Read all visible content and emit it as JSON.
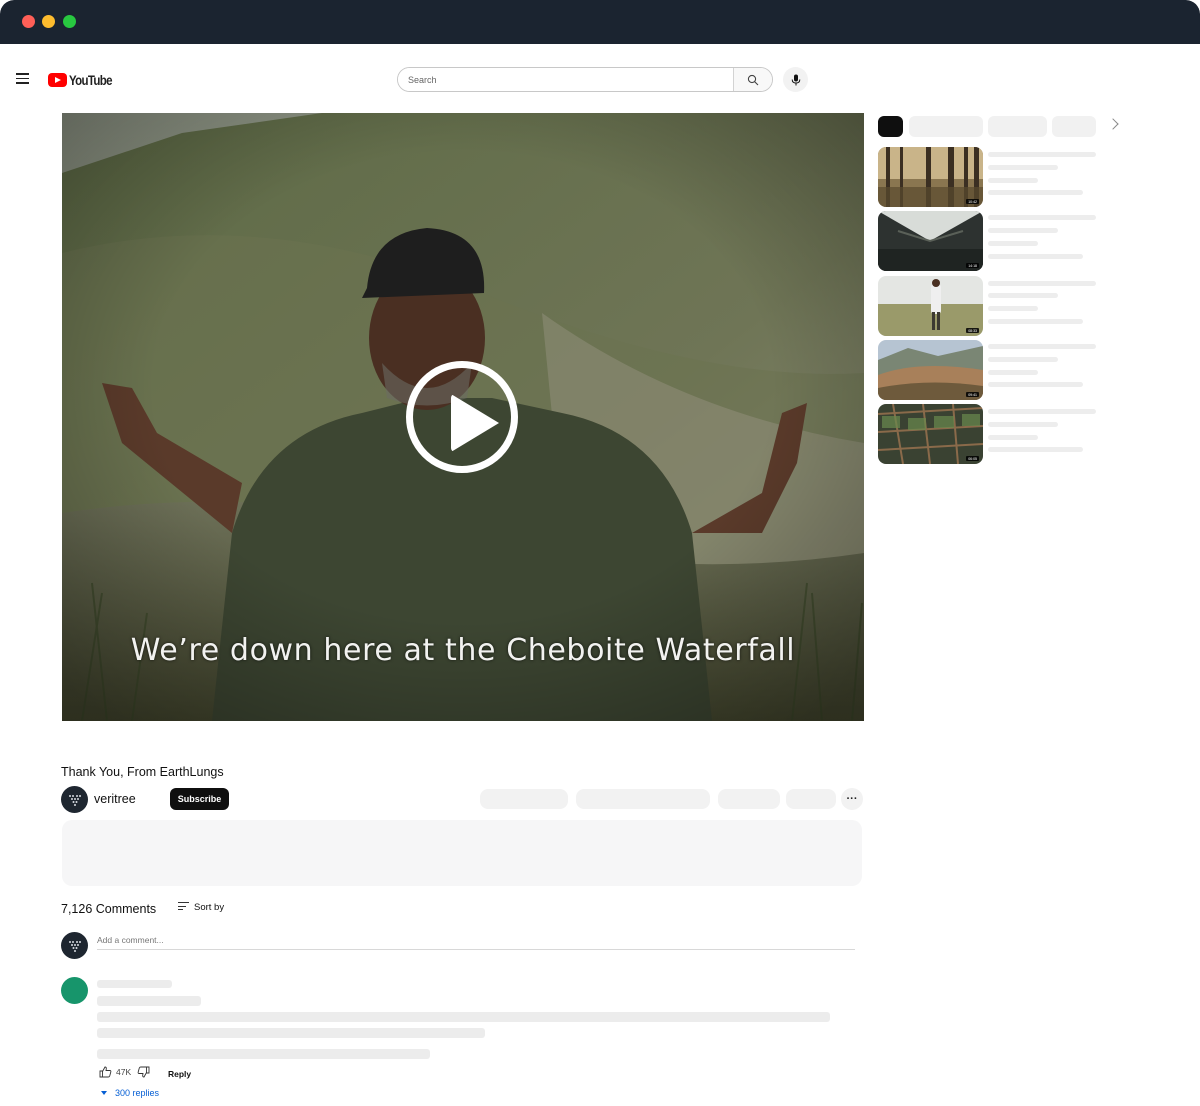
{
  "header": {
    "logo_text": "YouTube",
    "search_placeholder": "Search"
  },
  "video": {
    "caption": "We’re down here at the Cheboite Waterfall",
    "title": "Thank You, From EarthLungs"
  },
  "channel": {
    "name": "veritree",
    "subscribe_label": "Subscribe",
    "more_label": "···"
  },
  "comments": {
    "count_label": "7,126 Comments",
    "sort_label": "Sort by",
    "add_placeholder": "Add a comment...",
    "first": {
      "likes": "47K",
      "reply_label": "Reply",
      "replies_label": "300 replies"
    }
  },
  "sidebar": {
    "durations": [
      "10:42",
      "14:18",
      "08:33",
      "09:41",
      "06:05"
    ]
  },
  "colors": {
    "titlebar": "#1b2430",
    "brand_red": "#ff0000",
    "commenter_avatar": "#17956b",
    "link_blue": "#065fd4"
  }
}
